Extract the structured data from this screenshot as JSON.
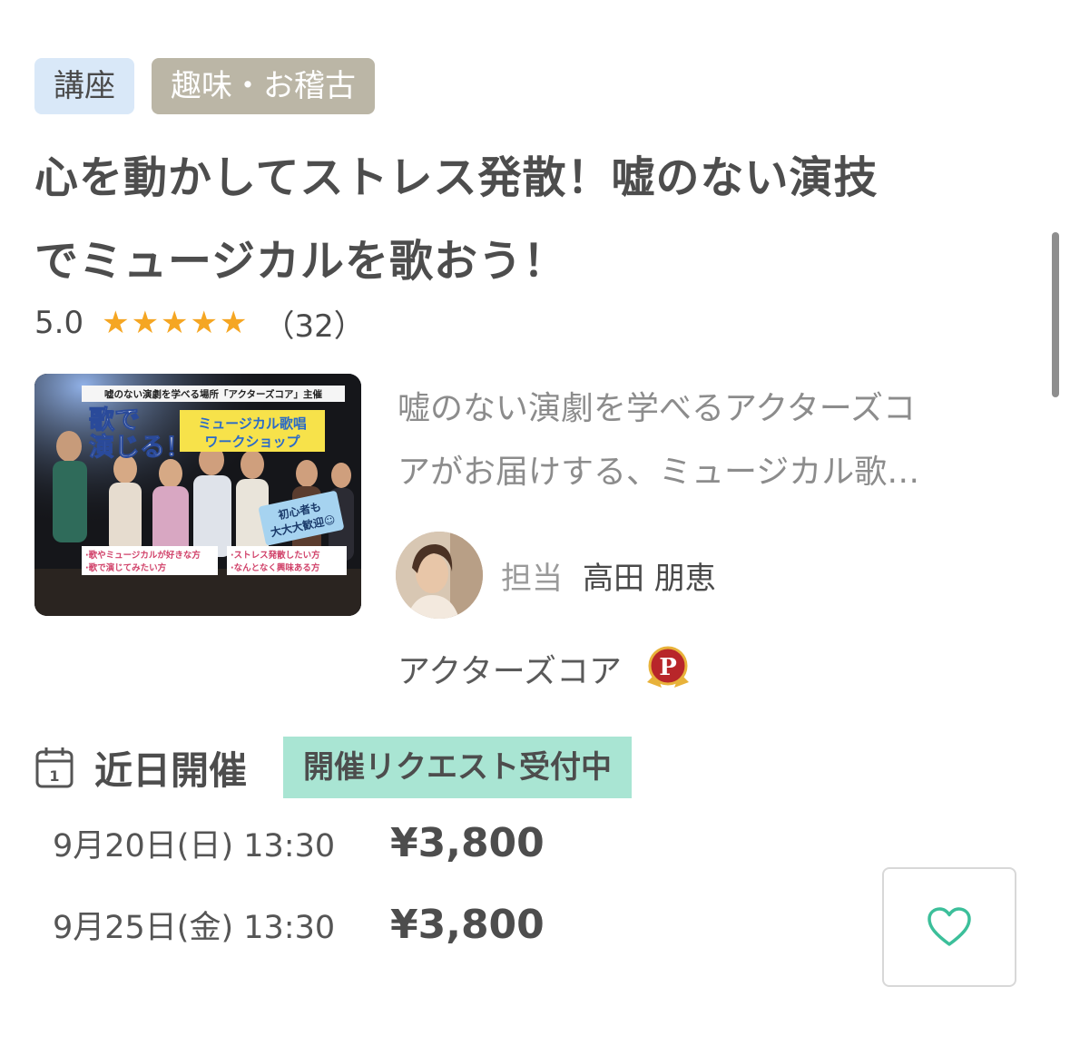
{
  "tags": {
    "category": "講座",
    "genre": "趣味・お稽古"
  },
  "title_line1": "心を動かしてストレス発散！嘘のない演技",
  "title_line2": "でミュージカルを歌おう！",
  "rating": {
    "score": "5.0",
    "stars": 5,
    "count": "（32）",
    "star_color": "#f5a623"
  },
  "thumbnail": {
    "top_banner": "嘘のない演劇を学べる場所「アクターズコア」主催",
    "headline_1": "歌で",
    "headline_2": "演じる！",
    "workshop_1": "ミュージカル歌唱",
    "workshop_2": "ワークショップ",
    "welcome_1": "初心者も",
    "welcome_2": "大大大歓迎☺",
    "target_1": "·歌やミュージカルが好きな方",
    "target_2": "·ストレス発散したい方",
    "target_3": "·歌で演じてみたい方",
    "target_4": "·なんとなく興味ある方"
  },
  "description": {
    "line1": "嘘のない演劇を学べるアクターズコ",
    "line2": "アがお届けする、ミュージカル歌…"
  },
  "teacher": {
    "label": "担当",
    "name": "高田 朋恵"
  },
  "organizer": {
    "name": "アクターズコア",
    "badge_letter": "P"
  },
  "schedule": {
    "title": "近日開催",
    "calendar_day": "1",
    "request_badge": "開催リクエスト受付中",
    "sessions": [
      {
        "date": "9月20日(日) 13:30",
        "price": "¥3,800"
      },
      {
        "date": "9月25日(金) 13:30",
        "price": "¥3,800"
      }
    ]
  },
  "colors": {
    "accent_teal": "#3cbf9a",
    "badge_bg": "#a9e5d3",
    "tag_blue_bg": "#d9e8f8",
    "tag_gray_bg": "#bbb6a6"
  }
}
